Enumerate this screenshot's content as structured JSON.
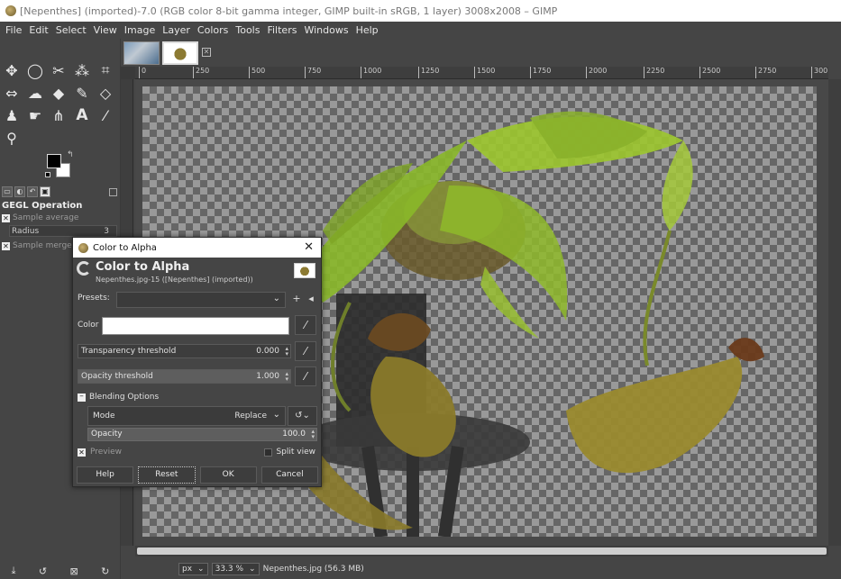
{
  "window": {
    "title": "[Nepenthes] (imported)-7.0 (RGB color 8-bit gamma integer, GIMP built-in sRGB, 1 layer) 3008x2008 – GIMP"
  },
  "menu": [
    "File",
    "Edit",
    "Select",
    "View",
    "Image",
    "Layer",
    "Colors",
    "Tools",
    "Filters",
    "Windows",
    "Help"
  ],
  "ruler": {
    "ticks": [
      "0",
      "250",
      "500",
      "750",
      "1000",
      "1250",
      "1500",
      "1750",
      "2000",
      "2250",
      "2500",
      "2750",
      "300"
    ]
  },
  "tool_options": {
    "title": "GEGL Operation",
    "sample_average": "Sample average",
    "radius_label": "Radius",
    "radius_value": "3",
    "sample_merged": "Sample merged"
  },
  "statusbar": {
    "unit": "px",
    "zoom": "33.3 %",
    "info": "Nepenthes.jpg (56.3 MB)"
  },
  "dialog": {
    "window_title": "Color to Alpha",
    "heading": "Color to Alpha",
    "subheading": "Nepenthes.jpg-15 ([Nepenthes] (imported))",
    "presets_label": "Presets:",
    "color_label": "Color",
    "color_value": "#ffffff",
    "transparency_label": "Transparency threshold",
    "transparency_value": "0.000",
    "opacity_threshold_label": "Opacity threshold",
    "opacity_threshold_value": "1.000",
    "blending_label": "Blending Options",
    "mode_label": "Mode",
    "mode_value": "Replace",
    "opacity_label": "Opacity",
    "opacity_value": "100.0",
    "preview_label": "Preview",
    "split_view_label": "Split view",
    "buttons": {
      "help": "Help",
      "reset": "Reset",
      "ok": "OK",
      "cancel": "Cancel"
    }
  },
  "colors": {
    "foreground": "#000000",
    "background": "#ffffff",
    "ui_bg": "#454545"
  }
}
